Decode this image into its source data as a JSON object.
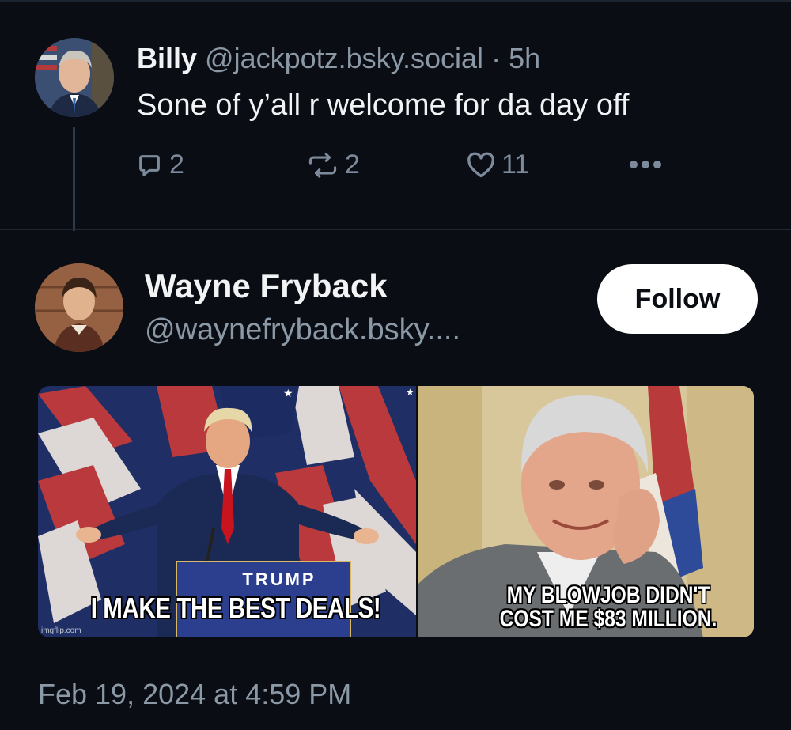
{
  "reply": {
    "author_name": "Billy",
    "author_handle": "@jackpotz.bsky.social",
    "separator": "·",
    "age": "5h",
    "text": "Sone of y’all r welcome for da day off",
    "avatar_icon": "user-avatar",
    "actions": {
      "reply_count": "2",
      "repost_count": "2",
      "like_count": "11"
    }
  },
  "post": {
    "author_name": "Wayne Fryback",
    "author_handle": "@waynefryback.bsky....",
    "follow_label": "Follow",
    "images": [
      {
        "caption": "I MAKE THE BEST DEALS!",
        "podium_text": "TRUMP",
        "watermark": "imgflip.com"
      },
      {
        "caption_line1": "MY BLOWJOB DIDN'T",
        "caption_line2": "COST ME $83 MILLION."
      }
    ],
    "timestamp": "Feb 19, 2024 at 4:59 PM"
  },
  "colors": {
    "background": "#0a0d13",
    "text_primary": "#f1f3f5",
    "text_secondary": "#8b98a5",
    "icon": "#7d8a9b",
    "follow_bg": "#ffffff"
  }
}
